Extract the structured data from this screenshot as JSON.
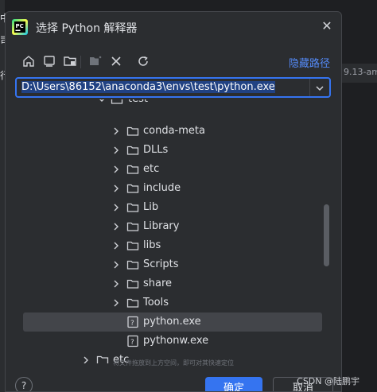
{
  "background": {
    "left_glyphs": [
      "中",
      "司",
      "行"
    ],
    "right_strip_text": "9.13-am"
  },
  "dialog": {
    "title": "选择 Python 解释器",
    "hide_path_link": "隐藏路径",
    "path_value": "D:\\Users\\86152\\anaconda3\\envs\\test\\python.exe",
    "hint": "将文件拖放到上方空间，即可对其快速定位",
    "ok_label": "确定",
    "cancel_label": "取消",
    "help_label": "?"
  },
  "tree": {
    "items": [
      {
        "label": "test",
        "type": "folder",
        "expanded": true,
        "depth": 1
      },
      {
        "label": "conda-meta",
        "type": "folder",
        "depth": 2
      },
      {
        "label": "DLLs",
        "type": "folder",
        "depth": 2
      },
      {
        "label": "etc",
        "type": "folder",
        "depth": 2
      },
      {
        "label": "include",
        "type": "folder",
        "depth": 2
      },
      {
        "label": "Lib",
        "type": "folder",
        "depth": 2
      },
      {
        "label": "Library",
        "type": "folder",
        "depth": 2
      },
      {
        "label": "libs",
        "type": "folder",
        "depth": 2
      },
      {
        "label": "Scripts",
        "type": "folder",
        "depth": 2
      },
      {
        "label": "share",
        "type": "folder",
        "depth": 2
      },
      {
        "label": "Tools",
        "type": "folder",
        "depth": 2
      },
      {
        "label": "python.exe",
        "type": "file",
        "selected": true,
        "depth": 2
      },
      {
        "label": "pythonw.exe",
        "type": "file",
        "depth": 2
      },
      {
        "label": "etc",
        "type": "folder",
        "depth": 0
      }
    ]
  },
  "watermark": "CSDN @陆鹏宇",
  "colors": {
    "accent": "#3574f0",
    "link": "#548af7",
    "selection": "#43454a"
  }
}
